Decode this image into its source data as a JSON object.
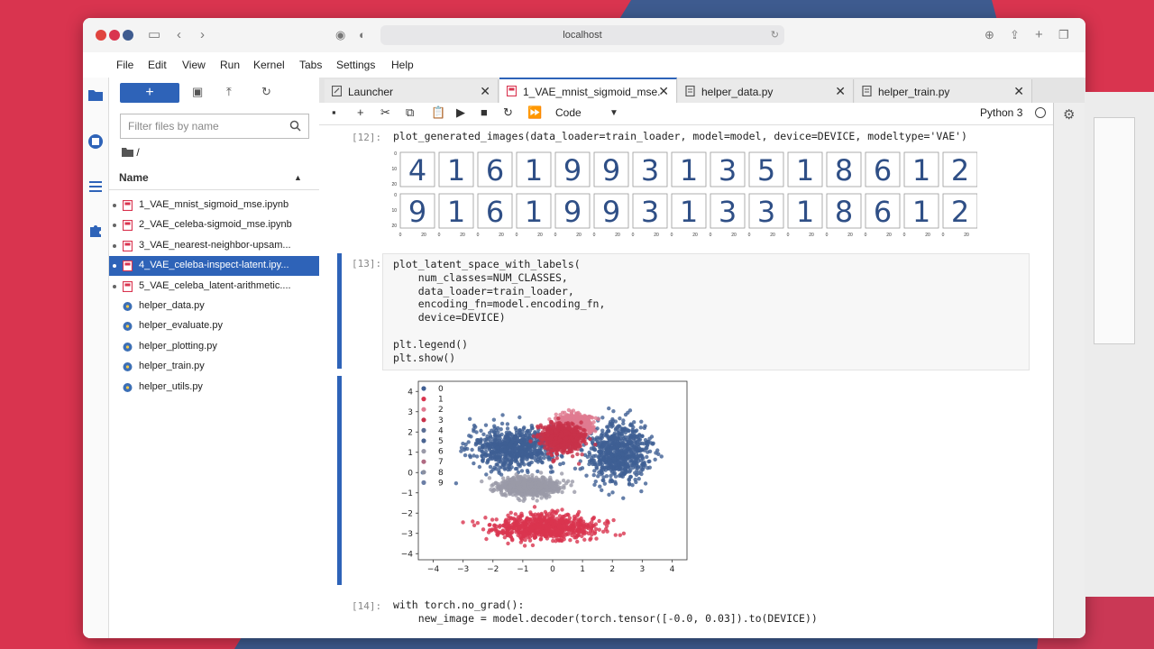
{
  "browser": {
    "url": "localhost"
  },
  "menubar": [
    "File",
    "Edit",
    "View",
    "Run",
    "Kernel",
    "Tabs",
    "Settings",
    "Help"
  ],
  "file_browser": {
    "new_label": "+",
    "filter_placeholder": "Filter files by name",
    "path": "/",
    "column_name": "Name",
    "files": [
      {
        "name": "1_VAE_mnist_sigmoid_mse.ipynb",
        "type": "notebook",
        "running": true,
        "selected": false
      },
      {
        "name": "2_VAE_celeba-sigmoid_mse.ipynb",
        "type": "notebook",
        "running": true,
        "selected": false
      },
      {
        "name": "3_VAE_nearest-neighbor-upsam...",
        "type": "notebook",
        "running": true,
        "selected": false
      },
      {
        "name": "4_VAE_celeba-inspect-latent.ipy...",
        "type": "notebook",
        "running": true,
        "selected": true
      },
      {
        "name": "5_VAE_celeba_latent-arithmetic....",
        "type": "notebook",
        "running": true,
        "selected": false
      },
      {
        "name": "helper_data.py",
        "type": "python",
        "running": false,
        "selected": false
      },
      {
        "name": "helper_evaluate.py",
        "type": "python",
        "running": false,
        "selected": false
      },
      {
        "name": "helper_plotting.py",
        "type": "python",
        "running": false,
        "selected": false
      },
      {
        "name": "helper_train.py",
        "type": "python",
        "running": false,
        "selected": false
      },
      {
        "name": "helper_utils.py",
        "type": "python",
        "running": false,
        "selected": false
      }
    ]
  },
  "tabs": [
    {
      "label": "Launcher",
      "icon": "launcher-icon",
      "active": false
    },
    {
      "label": "1_VAE_mnist_sigmoid_mse.",
      "icon": "notebook-icon",
      "active": true
    },
    {
      "label": "helper_data.py",
      "icon": "text-file-icon",
      "active": false
    },
    {
      "label": "helper_train.py",
      "icon": "text-file-icon",
      "active": false
    }
  ],
  "toolbar": {
    "cell_type": "Code",
    "kernel": "Python 3"
  },
  "cells": [
    {
      "prompt": "[12]:",
      "code": "plot_generated_images(data_loader=train_loader, model=model, device=DEVICE, modeltype='VAE')"
    },
    {
      "prompt": "[13]:",
      "code_lines": [
        "plot_latent_space_with_labels(",
        "    num_classes=NUM_CLASSES,",
        "    data_loader=train_loader,",
        "    encoding_fn=model.encoding_fn,",
        "    device=DEVICE)",
        "",
        "plt.legend()",
        "plt.show()"
      ]
    },
    {
      "prompt": "[14]:",
      "code_lines": [
        "with torch.no_grad():",
        "    new_image = model.decoder(torch.tensor([-0.0, 0.03]).to(DEVICE))"
      ]
    }
  ],
  "digits": {
    "original": [
      "4",
      "1",
      "6",
      "1",
      "9",
      "9",
      "3",
      "1",
      "3",
      "5",
      "1",
      "8",
      "6",
      "1",
      "2"
    ],
    "reconstructed": [
      "9",
      "1",
      "6",
      "1",
      "9",
      "9",
      "3",
      "1",
      "3",
      "3",
      "1",
      "8",
      "6",
      "1",
      "2"
    ],
    "y_ticks": [
      "0",
      "10",
      "20"
    ],
    "x_ticks": [
      "0",
      "20"
    ]
  },
  "chart_data": {
    "type": "scatter",
    "title": "",
    "xlabel": "",
    "ylabel": "",
    "xlim": [
      -4.5,
      4.5
    ],
    "ylim": [
      -4.3,
      4.5
    ],
    "x_ticks": [
      -4,
      -3,
      -2,
      -1,
      0,
      1,
      2,
      3,
      4
    ],
    "y_ticks": [
      -4,
      -3,
      -2,
      -1,
      0,
      1,
      2,
      3,
      4
    ],
    "legend": [
      "0",
      "1",
      "2",
      "3",
      "4",
      "5",
      "6",
      "7",
      "8",
      "9"
    ],
    "legend_placement": "top-left",
    "series_colors": [
      "#3f5f94",
      "#d9344f",
      "#e07a90",
      "#c8324a",
      "#5a6e94",
      "#4a6491",
      "#9a9aa8",
      "#b06a82",
      "#8a8fa0",
      "#6b7ea6"
    ],
    "clusters": [
      {
        "label": "0",
        "center": [
          -1.3,
          1.2
        ],
        "spread": [
          1.3,
          0.9
        ]
      },
      {
        "label": "0",
        "center": [
          2.2,
          1.0
        ],
        "spread": [
          0.9,
          1.3
        ]
      },
      {
        "label": "1",
        "center": [
          -0.2,
          -2.7
        ],
        "spread": [
          1.6,
          0.55
        ]
      },
      {
        "label": "2",
        "center": [
          0.7,
          2.3
        ],
        "spread": [
          0.5,
          0.5
        ]
      },
      {
        "label": "3",
        "center": [
          0.3,
          1.7
        ],
        "spread": [
          0.6,
          0.6
        ]
      },
      {
        "label": "6",
        "center": [
          -0.8,
          -0.7
        ],
        "spread": [
          0.9,
          0.4
        ]
      }
    ]
  }
}
